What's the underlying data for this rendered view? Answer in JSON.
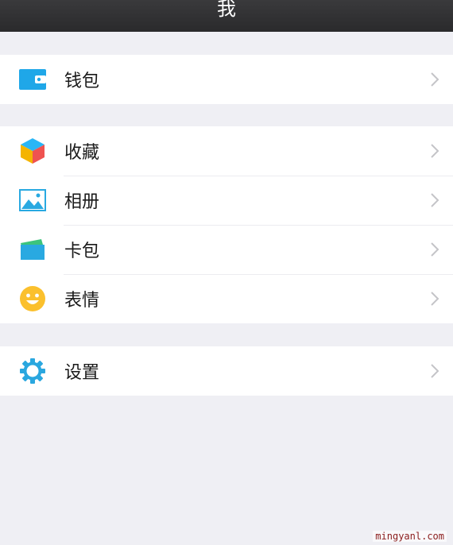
{
  "header": {
    "title": "我"
  },
  "groups": [
    {
      "items": [
        {
          "label": "钱包",
          "icon": "wallet-icon"
        }
      ]
    },
    {
      "items": [
        {
          "label": "收藏",
          "icon": "favorites-cube-icon"
        },
        {
          "label": "相册",
          "icon": "album-photo-icon"
        },
        {
          "label": "卡包",
          "icon": "card-wallet-icon"
        },
        {
          "label": "表情",
          "icon": "smiley-face-icon"
        }
      ]
    },
    {
      "items": [
        {
          "label": "设置",
          "icon": "settings-gear-icon"
        }
      ]
    }
  ],
  "watermark": "mingyanl.com",
  "colors": {
    "background": "#efeff4",
    "header": "#2e2e30",
    "wallet": "#1fa7e8",
    "chevron": "#c4c4c8"
  }
}
